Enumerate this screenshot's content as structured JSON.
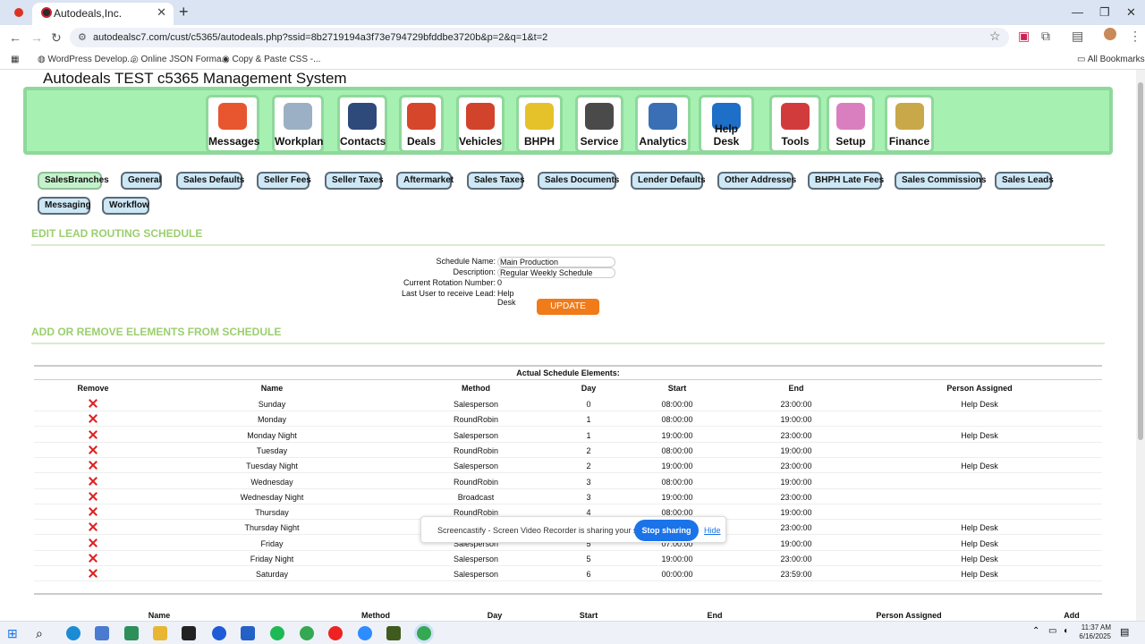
{
  "browser": {
    "tab_title": "Autodeals,Inc.",
    "url": "autodealsc7.com/cust/c5365/autodeals.php?ssid=8b2719194a3f73e794729bfddbe3720b&p=2&q=1&t=2",
    "bookmarks": [
      "WordPress Develop...",
      "Online JSON Forma...",
      "Copy & Paste CSS -..."
    ],
    "all_bookmarks": "All Bookmarks"
  },
  "app": {
    "title": "Autodeals TEST c5365 Management System",
    "menu": [
      {
        "label": "Messages",
        "icon": "messages-icon",
        "color": "#e8562f"
      },
      {
        "label": "Workplan",
        "icon": "clock-icon",
        "color": "#9bb0c4"
      },
      {
        "label": "Contacts",
        "icon": "contacts-icon",
        "color": "#2d4a7a"
      },
      {
        "label": "Deals",
        "icon": "deals-icon",
        "color": "#d6462b"
      },
      {
        "label": "Vehicles",
        "icon": "car-icon",
        "color": "#d2432c"
      },
      {
        "label": "BHPH",
        "icon": "money-icon",
        "color": "#e6c22a"
      },
      {
        "label": "Service",
        "icon": "tools-icon",
        "color": "#4a4a4a"
      },
      {
        "label": "Analytics",
        "icon": "chart-icon",
        "color": "#3b6fb5"
      },
      {
        "label": "Help Desk",
        "icon": "info-icon",
        "color": "#1d6fc7"
      },
      {
        "label": "Tools",
        "icon": "gears-icon",
        "color": "#d23b3b"
      },
      {
        "label": "Setup",
        "icon": "setup-gear-icon",
        "color": "#d97fc0"
      },
      {
        "label": "Finance",
        "icon": "moneybag-icon",
        "color": "#c9a84a"
      }
    ],
    "subtabs": [
      "SalesBranches",
      "General",
      "Sales Defaults",
      "Seller Fees",
      "Seller Taxes",
      "Aftermarket",
      "Sales Taxes",
      "Sales Documents",
      "Lender Defaults",
      "Other Addresses",
      "BHPH Late Fees",
      "Sales Commissions",
      "Sales Leads",
      "Messaging",
      "Workflow"
    ]
  },
  "edit": {
    "heading": "EDIT LEAD ROUTING SCHEDULE",
    "schedule_name_label": "Schedule Name:",
    "schedule_name": "Main Production",
    "description_label": "Description:",
    "description": "Regular Weekly Schedule",
    "rotation_label": "Current Rotation Number:",
    "rotation": "0",
    "last_user_label": "Last User to receive Lead:",
    "last_user": "Help Desk",
    "update": "UPDATE"
  },
  "elements": {
    "heading": "ADD OR REMOVE ELEMENTS FROM SCHEDULE",
    "table_title": "Actual Schedule Elements:",
    "columns": [
      "Remove",
      "Name",
      "Method",
      "Day",
      "Start",
      "End",
      "Person Assigned"
    ],
    "rows": [
      [
        "Sunday",
        "Salesperson",
        "0",
        "08:00:00",
        "23:00:00",
        "Help Desk"
      ],
      [
        "Monday",
        "RoundRobin",
        "1",
        "08:00:00",
        "19:00:00",
        ""
      ],
      [
        "Monday Night",
        "Salesperson",
        "1",
        "19:00:00",
        "23:00:00",
        "Help Desk"
      ],
      [
        "Tuesday",
        "RoundRobin",
        "2",
        "08:00:00",
        "19:00:00",
        ""
      ],
      [
        "Tuesday Night",
        "Salesperson",
        "2",
        "19:00:00",
        "23:00:00",
        "Help Desk"
      ],
      [
        "Wednesday",
        "RoundRobin",
        "3",
        "08:00:00",
        "19:00:00",
        ""
      ],
      [
        "Wednesday Night",
        "Broadcast",
        "3",
        "19:00:00",
        "23:00:00",
        ""
      ],
      [
        "Thursday",
        "RoundRobin",
        "4",
        "08:00:00",
        "19:00:00",
        ""
      ],
      [
        "Thursday Night",
        "Salesperson",
        "4",
        "19:00:00",
        "23:00:00",
        "Help Desk"
      ],
      [
        "Friday",
        "Salesperson",
        "5",
        "07:00:00",
        "19:00:00",
        "Help Desk"
      ],
      [
        "Friday Night",
        "Salesperson",
        "5",
        "19:00:00",
        "23:00:00",
        "Help Desk"
      ],
      [
        "Saturday",
        "Salesperson",
        "6",
        "00:00:00",
        "23:59:00",
        "Help Desk"
      ]
    ],
    "add_columns": [
      "Name",
      "Method",
      "Day",
      "Start",
      "End",
      "Person Assigned",
      "Add"
    ]
  },
  "sharing": {
    "text": "Screencastify - Screen Video Recorder is sharing your screen.",
    "stop": "Stop sharing",
    "hide": "Hide"
  },
  "clock": {
    "time": "11:37 AM",
    "date": "6/16/2025"
  }
}
